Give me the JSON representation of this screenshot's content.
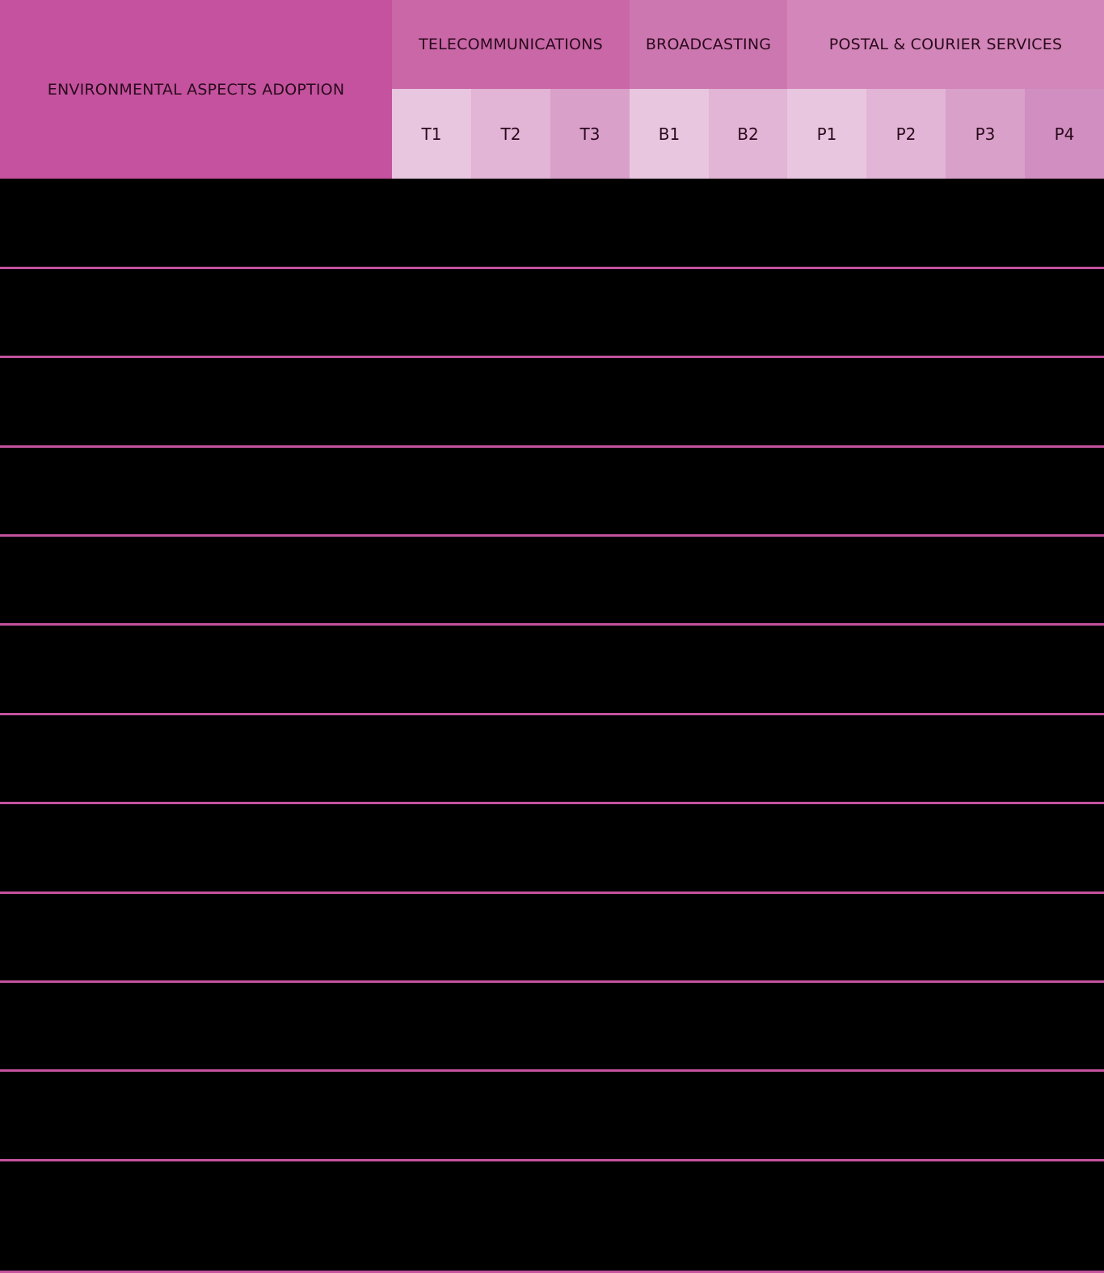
{
  "colors": {
    "main_header_bg": "#c4529e",
    "telecom_header_bg": "#c967a7",
    "broadcast_header_bg": "#cd77b1",
    "postal_header_bg": "#d386b9",
    "sub_light": "#e9c6df",
    "sub_mid": "#e2b4d5",
    "sub_dark": "#d9a0ca",
    "sub_darker": "#d08fc0",
    "row_line": "#c4529e",
    "body_bg": "#000000",
    "header_text": "#2a0a1c"
  },
  "table": {
    "main_header": "ENVIRONMENTAL ASPECTS ADOPTION",
    "groups": [
      {
        "label": "TELECOMMUNICATIONS"
      },
      {
        "label": "BROADCASTING"
      },
      {
        "label": "POSTAL & COURIER SERVICES"
      }
    ],
    "subheaders": [
      "T1",
      "T2",
      "T3",
      "B1",
      "B2",
      "P1",
      "P2",
      "P3",
      "P4"
    ],
    "row_count": 12
  }
}
